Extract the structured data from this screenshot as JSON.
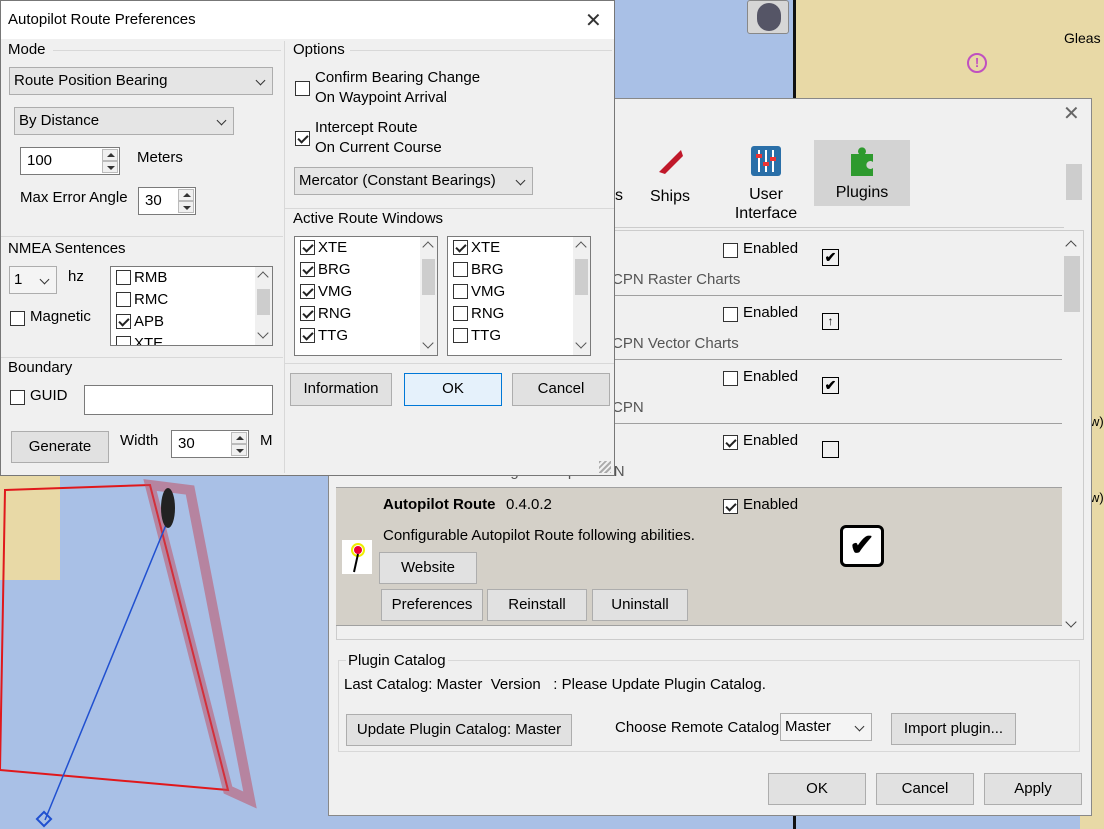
{
  "colors": {
    "map_water": "#a9c0e6",
    "map_land": "#e8d9a6",
    "route_red": "#e0181c",
    "selected_row": "#d4d0c8",
    "ok_border": "#0078d7"
  },
  "map": {
    "label_top_right": "Gleas",
    "side_text_1": "w)",
    "side_text_2": "w)"
  },
  "autopilot_dialog": {
    "title": "Autopilot Route Preferences",
    "mode_group": "Mode",
    "mode_select": "Route Position Bearing",
    "distance_select": "By Distance",
    "distance_value": "100",
    "distance_unit": "Meters",
    "max_error_label": "Max Error Angle",
    "max_error_value": "30",
    "nmea_group": "NMEA Sentences",
    "rate_select": "1",
    "rate_unit": "hz",
    "magnetic_label": "Magnetic",
    "nmea_items": [
      {
        "label": "RMB",
        "checked": false
      },
      {
        "label": "RMC",
        "checked": false
      },
      {
        "label": "APB",
        "checked": true
      },
      {
        "label": "XTE",
        "checked": false
      }
    ],
    "boundary_group": "Boundary",
    "guid_label": "GUID",
    "guid_value": "",
    "generate_button": "Generate",
    "width_label": "Width",
    "width_value": "30",
    "width_unit": "M",
    "options_group": "Options",
    "confirm_label_1": "Confirm Bearing Change",
    "confirm_label_2": "On Waypoint Arrival",
    "intercept_label_1": "Intercept Route",
    "intercept_label_2": "On Current Course",
    "projection_select": "Mercator (Constant Bearings)",
    "active_windows_group": "Active Route Windows",
    "windows_left": [
      {
        "label": "XTE",
        "checked": true
      },
      {
        "label": "BRG",
        "checked": true
      },
      {
        "label": "VMG",
        "checked": true
      },
      {
        "label": "RNG",
        "checked": true
      },
      {
        "label": "TTG",
        "checked": true
      }
    ],
    "windows_right": [
      {
        "label": "XTE",
        "checked": true
      },
      {
        "label": "BRG",
        "checked": false
      },
      {
        "label": "VMG",
        "checked": false
      },
      {
        "label": "RNG",
        "checked": false
      },
      {
        "label": "TTG",
        "checked": false
      }
    ],
    "information_button": "Information",
    "ok_button": "OK",
    "cancel_button": "Cancel"
  },
  "options_dialog": {
    "tabs": [
      {
        "label": "s"
      },
      {
        "label": "Ships"
      },
      {
        "label": "User\nInterface"
      },
      {
        "label": "Plugins"
      }
    ],
    "plugins": [
      {
        "desc": "CPN Raster Charts",
        "enabled": false,
        "status_icon": "checked-box-icon"
      },
      {
        "desc": "CPN Vector Charts",
        "enabled": false,
        "status_icon": "upload-box-icon"
      },
      {
        "desc": "CPN",
        "enabled": false,
        "status_icon": "checked-box-icon"
      },
      {
        "desc": "GPS Odometer Plugin for OpenCPN",
        "enabled": true,
        "status_icon": "empty-box-icon"
      }
    ],
    "enabled_label": "Enabled",
    "selected_plugin": {
      "name": "Autopilot Route",
      "version": "0.4.0.2",
      "enabled": true,
      "description": "Configurable Autopilot Route following abilities.",
      "website_button": "Website",
      "preferences_button": "Preferences",
      "reinstall_button": "Reinstall",
      "uninstall_button": "Uninstall"
    },
    "catalog_group": "Plugin Catalog",
    "catalog_status": "Last Catalog: Master  Version   : Please Update Plugin Catalog.",
    "update_button": "Update Plugin Catalog: Master",
    "remote_catalog_label": "Choose Remote Catalog",
    "remote_catalog_value": "Master",
    "import_button": "Import plugin...",
    "ok_button": "OK",
    "cancel_button": "Cancel",
    "apply_button": "Apply"
  }
}
